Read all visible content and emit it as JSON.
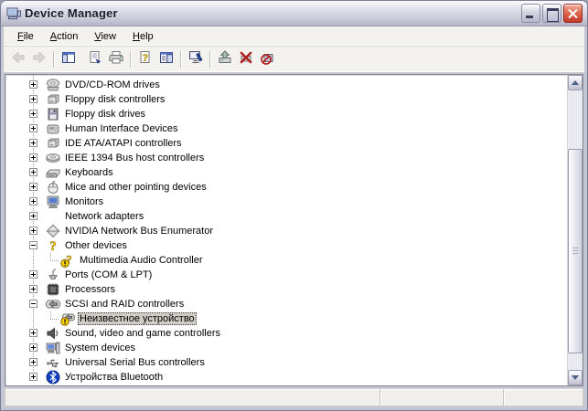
{
  "window": {
    "title": "Device Manager"
  },
  "menubar": {
    "items": [
      {
        "label": "File"
      },
      {
        "label": "Action"
      },
      {
        "label": "View"
      },
      {
        "label": "Help"
      }
    ]
  },
  "toolbar": {
    "buttons": [
      {
        "icon": "back-arrow-icon",
        "name": "back-button",
        "disabled": true
      },
      {
        "icon": "forward-arrow-icon",
        "name": "forward-button",
        "disabled": true,
        "separator_after": true
      },
      {
        "icon": "console-tree-icon",
        "name": "show-hide-console-tree-button",
        "gap_after": true
      },
      {
        "icon": "properties-icon",
        "name": "properties-button"
      },
      {
        "icon": "print-icon",
        "name": "print-button",
        "separator_after": true
      },
      {
        "icon": "help-doc-icon",
        "name": "help-button"
      },
      {
        "icon": "pane-right-icon",
        "name": "show-hide-action-pane-button",
        "separator_after": true
      },
      {
        "icon": "scan-hardware-icon",
        "name": "scan-for-hardware-changes-button",
        "separator_after": true
      },
      {
        "icon": "update-driver-icon",
        "name": "update-driver-button"
      },
      {
        "icon": "disable-device-icon",
        "name": "disable-device-button"
      },
      {
        "icon": "uninstall-device-icon",
        "name": "uninstall-device-button"
      }
    ]
  },
  "tree": {
    "items": [
      {
        "label": "DVD/CD-ROM drives",
        "icon": "dvd-drive-icon",
        "level": 0,
        "expander": "+"
      },
      {
        "label": "Floppy disk controllers",
        "icon": "controller-icon",
        "level": 0,
        "expander": "+"
      },
      {
        "label": "Floppy disk drives",
        "icon": "floppy-icon",
        "level": 0,
        "expander": "+"
      },
      {
        "label": "Human Interface Devices",
        "icon": "hid-icon",
        "level": 0,
        "expander": "+"
      },
      {
        "label": "IDE ATA/ATAPI controllers",
        "icon": "controller-icon",
        "level": 0,
        "expander": "+"
      },
      {
        "label": "IEEE 1394 Bus host controllers",
        "icon": "ieee1394-icon",
        "level": 0,
        "expander": "+"
      },
      {
        "label": "Keyboards",
        "icon": "keyboard-icon",
        "level": 0,
        "expander": "+"
      },
      {
        "label": "Mice and other pointing devices",
        "icon": "mouse-icon",
        "level": 0,
        "expander": "+"
      },
      {
        "label": "Monitors",
        "icon": "monitor-icon",
        "level": 0,
        "expander": "+"
      },
      {
        "label": "Network adapters",
        "icon": "network-icon",
        "level": 0,
        "expander": "+"
      },
      {
        "label": "NVIDIA Network Bus Enumerator",
        "icon": "diamond-icon",
        "level": 0,
        "expander": "+"
      },
      {
        "label": "Other devices",
        "icon": "question-icon",
        "level": 0,
        "expander": "-"
      },
      {
        "label": "Multimedia Audio Controller",
        "icon": "question-warn-icon",
        "level": 1
      },
      {
        "label": "Ports (COM & LPT)",
        "icon": "ports-icon",
        "level": 0,
        "expander": "+"
      },
      {
        "label": "Processors",
        "icon": "processor-icon",
        "level": 0,
        "expander": "+"
      },
      {
        "label": "SCSI and RAID controllers",
        "icon": "scsi-icon",
        "level": 0,
        "expander": "-"
      },
      {
        "label": "Неизвестное устройство",
        "icon": "scsi-warn-icon",
        "level": 1,
        "selected": true
      },
      {
        "label": "Sound, video and game controllers",
        "icon": "speaker-icon",
        "level": 0,
        "expander": "+"
      },
      {
        "label": "System devices",
        "icon": "system-icon",
        "level": 0,
        "expander": "+"
      },
      {
        "label": "Universal Serial Bus controllers",
        "icon": "usb-icon",
        "level": 0,
        "expander": "+"
      },
      {
        "label": "Устройства Bluetooth",
        "icon": "bluetooth-icon",
        "level": 0,
        "expander": "+"
      }
    ]
  },
  "scrollbar": {
    "thumb_top_pct": 21,
    "thumb_height_pct": 73
  },
  "statusbar": {
    "text": ""
  },
  "colors": {
    "selection_bg": "#cfccc6",
    "close_button": "#c23a28",
    "warning_yellow": "#ffd400",
    "bluetooth_blue": "#1040c0"
  }
}
